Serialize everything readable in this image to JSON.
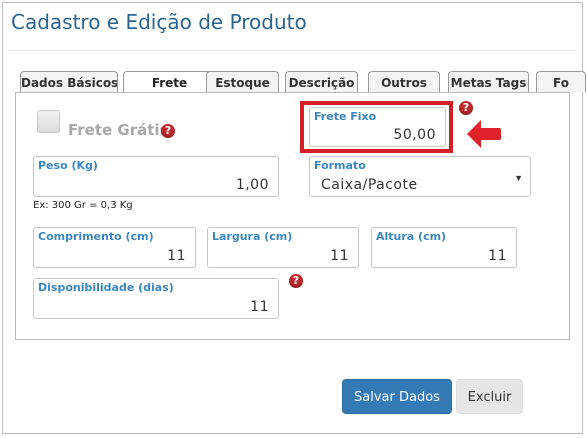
{
  "page": {
    "title": "Cadastro e Edição de Produto"
  },
  "tabs": [
    {
      "label": "Dados Básicos",
      "active": false
    },
    {
      "label": "Frete",
      "active": true
    },
    {
      "label": "Estoque",
      "active": false
    },
    {
      "label": "Descrição",
      "active": false
    },
    {
      "label": "Outros",
      "active": false
    },
    {
      "label": "Metas Tags",
      "active": false
    },
    {
      "label": "Fo",
      "active": false
    }
  ],
  "frete": {
    "frete_gratis_label": "Frete Grátis",
    "frete_gratis_checked": false,
    "frete_fixo": {
      "label": "Frete Fixo",
      "value": "50,00"
    },
    "peso": {
      "label": "Peso (Kg)",
      "value": "1,00",
      "hint": "Ex: 300 Gr = 0,3 Kg"
    },
    "formato": {
      "label": "Formato",
      "value": "Caixa/Pacote"
    },
    "comprimento": {
      "label": "Comprimento (cm)",
      "value": "11"
    },
    "largura": {
      "label": "Largura (cm)",
      "value": "11"
    },
    "altura": {
      "label": "Altura (cm)",
      "value": "11"
    },
    "disponibilidade": {
      "label": "Disponibilidade (dias)",
      "value": "11"
    }
  },
  "icons": {
    "help": "?",
    "select_arrow": "▼"
  },
  "buttons": {
    "save": "Salvar Dados",
    "delete": "Excluir"
  },
  "colors": {
    "title": "#2a6490",
    "field_label": "#3a86c2",
    "highlight": "#d32027",
    "primary": "#337ab7",
    "help": "#c0282d"
  }
}
